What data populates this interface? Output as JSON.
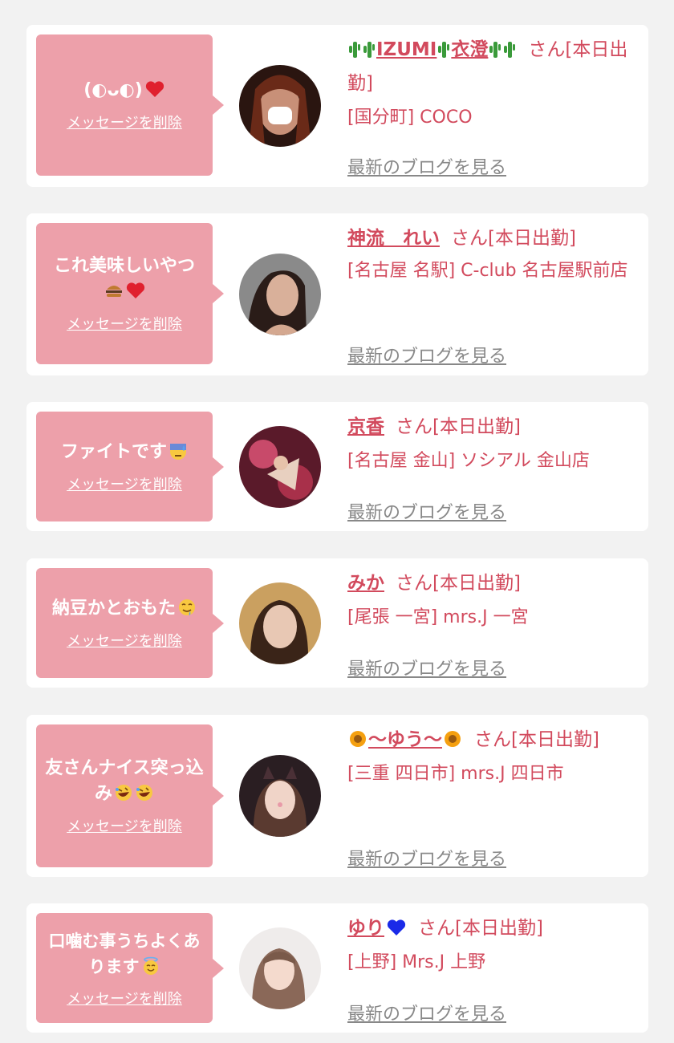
{
  "colors": {
    "background": "#f2f2f2",
    "card": "#ffffff",
    "bubble": "#eda0aa",
    "accent": "#d24a5d",
    "link_gray": "#888888"
  },
  "cards": [
    {
      "message": "(◐ᴗ◐)",
      "message_icon": "red-heart-icon",
      "delete_label": "メッセージを削除",
      "name": "IZUMI",
      "name2": "衣澄",
      "name_icon": "cactus-icon",
      "san_label": "さん[本日出勤]",
      "shop": "[国分町] COCO",
      "blog_label": "最新のブログを見る"
    },
    {
      "message": "これ美味しいやつ",
      "message_icon": "hamburger-icon red-heart-icon",
      "delete_label": "メッセージを削除",
      "name": "神流　れい",
      "san_label": "さん[本日出勤]",
      "shop": "[名古屋 名駅] C-club 名古屋駅前店",
      "blog_label": "最新のブログを見る"
    },
    {
      "message": "ファイトです",
      "message_icon": "sweat-face-icon",
      "delete_label": "メッセージを削除",
      "name": "京香",
      "san_label": "さん[本日出勤]",
      "shop": "[名古屋 金山] ソシアル 金山店",
      "blog_label": "最新のブログを見る"
    },
    {
      "message": "納豆かとおもた",
      "message_icon": "drooling-face-icon",
      "delete_label": "メッセージを削除",
      "name": "みか",
      "san_label": "さん[本日出勤]",
      "shop": "[尾張 一宮] mrs.J 一宮",
      "blog_label": "最新のブログを見る"
    },
    {
      "message": "友さんナイス突っ込み",
      "message_icon": "rofl-face-icon rofl-face-icon",
      "delete_label": "メッセージを削除",
      "name": "〜ゆう〜",
      "name_icon": "sunflower-icon",
      "san_label": "さん[本日出勤]",
      "shop": "[三重 四日市] mrs.J 四日市",
      "blog_label": "最新のブログを見る"
    },
    {
      "message": "口噛む事うちよくあります",
      "message_icon": "halo-face-icon",
      "delete_label": "メッセージを削除",
      "name": "ゆり",
      "name_icon": "blue-heart-icon",
      "san_label": "さん[本日出勤]",
      "shop": "[上野] Mrs.J 上野",
      "blog_label": "最新のブログを見る"
    }
  ]
}
